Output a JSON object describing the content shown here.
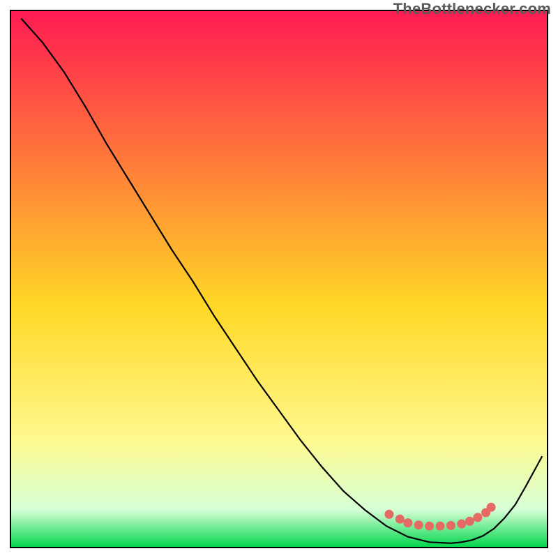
{
  "watermark": "TheBottlenecker.com",
  "chart_data": {
    "type": "line",
    "title": "",
    "xlabel": "",
    "ylabel": "",
    "xlim": [
      0,
      100
    ],
    "ylim": [
      0,
      100
    ],
    "background_gradient": {
      "top": "#ff1a52",
      "mid_upper": "#ff7a3a",
      "mid": "#ffd826",
      "lower": "#fff98f",
      "near_bottom": "#d6ffd6",
      "bottom": "#00d54b"
    },
    "series": [
      {
        "name": "bottleneck-curve",
        "x": [
          2,
          6,
          10,
          14,
          18,
          22,
          26,
          30,
          34,
          38,
          42,
          46,
          50,
          54,
          58,
          62,
          66,
          70,
          74,
          78,
          82,
          84,
          86,
          88,
          90,
          92,
          94,
          96,
          99
        ],
        "y": [
          98.5,
          94.0,
          88.5,
          82.0,
          75.0,
          68.5,
          62.0,
          55.5,
          49.5,
          43.0,
          37.0,
          31.0,
          25.5,
          20.0,
          15.0,
          10.5,
          7.0,
          4.0,
          2.0,
          1.0,
          0.8,
          1.0,
          1.4,
          2.2,
          3.5,
          5.5,
          8.0,
          11.5,
          17.0
        ]
      },
      {
        "name": "optimal-dots",
        "x": [
          70.5,
          72.5,
          74.0,
          76.0,
          78.0,
          80.0,
          82.0,
          84.0,
          85.5,
          87.0,
          88.5,
          89.5
        ],
        "y": [
          6.2,
          5.3,
          4.6,
          4.2,
          4.0,
          4.0,
          4.1,
          4.4,
          4.9,
          5.6,
          6.5,
          7.5
        ]
      }
    ],
    "dot_color": "#e46a63",
    "line_color": "#000000"
  }
}
